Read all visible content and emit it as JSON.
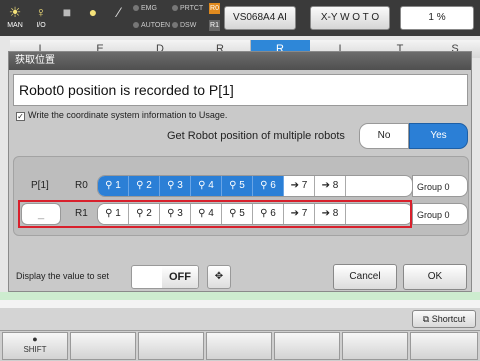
{
  "toolbar": {
    "icons": [
      {
        "name": "man-icon",
        "label": "MAN"
      },
      {
        "name": "io-icon",
        "label": "I/O"
      },
      {
        "name": "stop-icon",
        "label": ""
      },
      {
        "name": "bulb-icon",
        "label": ""
      },
      {
        "name": "pen-icon",
        "label": ""
      }
    ],
    "indicators": [
      "EMG",
      "PRTCT",
      "AUTOEN",
      "DSW"
    ],
    "r0": "R0",
    "r1": "R1",
    "program_name": "VS068A4 AI",
    "coord_mode": "X-Y W O T O",
    "speed": "1 %"
  },
  "bg_columns": [
    "I",
    "E",
    "D",
    "R",
    "R",
    "I",
    "T",
    "S"
  ],
  "dialog": {
    "title": "获取位置",
    "message": "Robot0 position is recorded to P[1]",
    "checkbox_label": "Write the coordinate system information to Usage.",
    "checkbox_checked": "✓",
    "get_multi_label": "Get Robot position of multiple robots",
    "no_label": "No",
    "yes_label": "Yes",
    "p_label": "P[1]",
    "p1_value": "_",
    "rows": [
      {
        "robot": "R0",
        "axes": [
          "1",
          "2",
          "3",
          "4",
          "5",
          "6"
        ],
        "ext": [
          "7",
          "8"
        ],
        "group": "Group 0"
      },
      {
        "robot": "R1",
        "axes": [
          "1",
          "2",
          "3",
          "4",
          "5",
          "6"
        ],
        "ext": [
          "7",
          "8"
        ],
        "group": "Group 0"
      }
    ],
    "display_label": "Display the value to set",
    "toggle_state": "OFF",
    "cancel_label": "Cancel",
    "ok_label": "OK"
  },
  "shortcut_label": "Shortcut",
  "shift_label": "SHIFT",
  "colors": {
    "accent": "#2b7fd6",
    "highlight": "#d8202c"
  }
}
